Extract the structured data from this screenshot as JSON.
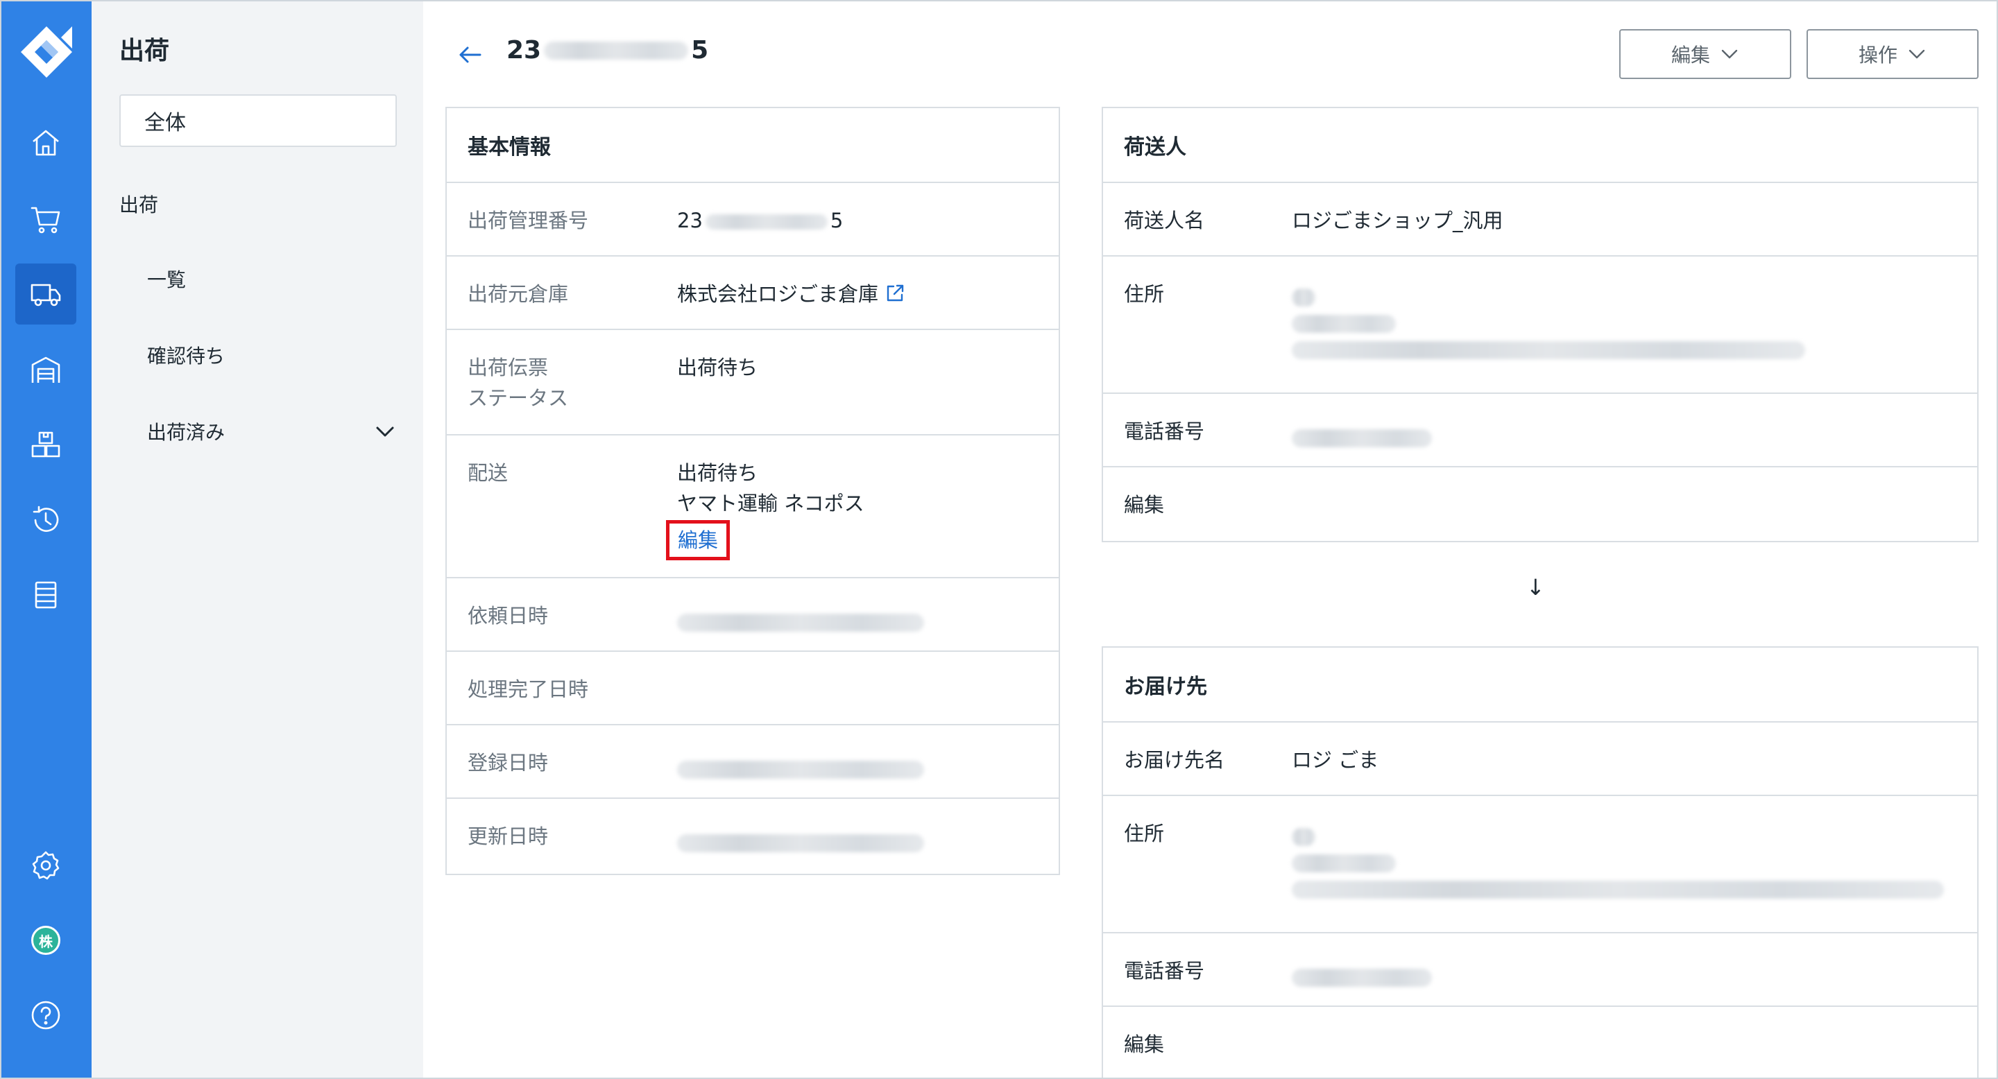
{
  "rail": {
    "nav": [
      {
        "icon": "home-icon"
      },
      {
        "icon": "cart-icon"
      },
      {
        "icon": "truck-icon",
        "active": true
      },
      {
        "icon": "warehouse-icon"
      },
      {
        "icon": "boxes-icon"
      },
      {
        "icon": "history-icon"
      },
      {
        "icon": "list-icon"
      }
    ],
    "footer": [
      {
        "icon": "gear-icon"
      },
      {
        "icon": "corporation-icon",
        "label": "株"
      },
      {
        "icon": "help-icon"
      }
    ]
  },
  "subnav": {
    "title": "出荷",
    "scope": "全体",
    "group": "出荷",
    "items": [
      "一覧",
      "確認待ち",
      "出荷済み"
    ]
  },
  "header": {
    "id_prefix": "23",
    "id_suffix": "5",
    "buttons": {
      "edit": "編集",
      "actions": "操作"
    }
  },
  "basic_info": {
    "title": "基本情報",
    "rows": {
      "management_no": {
        "label": "出荷管理番号",
        "prefix": "23",
        "suffix": "5"
      },
      "warehouse": {
        "label": "出荷元倉庫",
        "value": "株式会社ロジごま倉庫"
      },
      "slip_status": {
        "label_line1": "出荷伝票",
        "label_line2": "ステータス",
        "value": "出荷待ち"
      },
      "delivery": {
        "label": "配送",
        "status": "出荷待ち",
        "carrier": "ヤマト運輸 ネコポス",
        "edit": "編集"
      },
      "requested_at": {
        "label": "依頼日時"
      },
      "completed_at": {
        "label": "処理完了日時"
      },
      "created_at": {
        "label": "登録日時"
      },
      "updated_at": {
        "label": "更新日時"
      }
    }
  },
  "shipper": {
    "title": "荷送人",
    "name_label": "荷送人名",
    "name": "ロジごまショップ_汎用",
    "address_label": "住所",
    "phone_label": "電話番号",
    "edit": "編集"
  },
  "arrow": "↓",
  "recipient": {
    "title": "お届け先",
    "name_label": "お届け先名",
    "name": "ロジ ごま",
    "address_label": "住所",
    "phone_label": "電話番号",
    "edit": "編集"
  },
  "colors": {
    "rail": "#2f82e6",
    "rail_active": "#1d66c9",
    "link": "#1f6fd1",
    "highlight": "#e3101b"
  }
}
